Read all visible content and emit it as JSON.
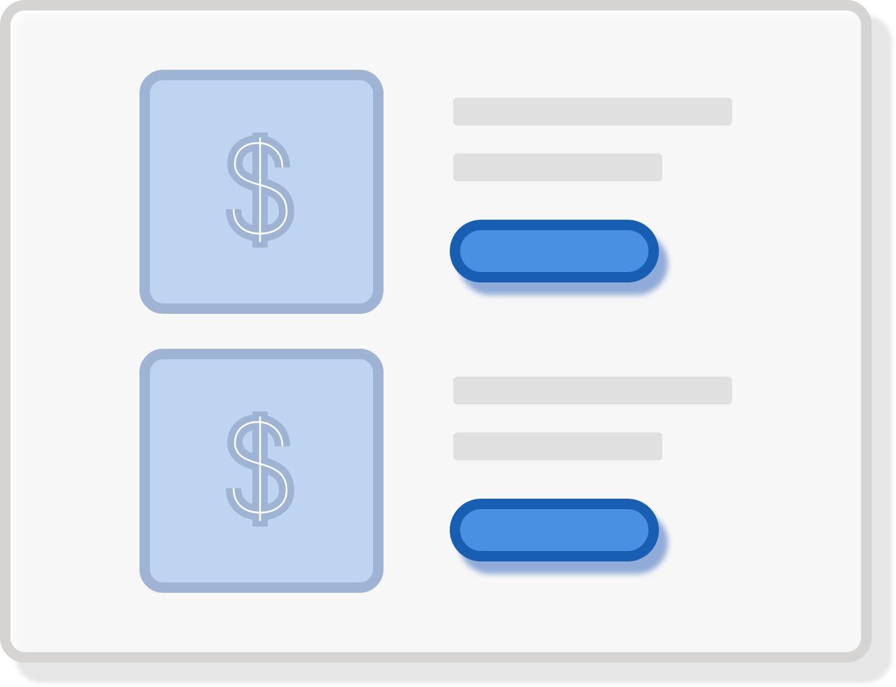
{
  "window": {
    "title": ""
  },
  "list": {
    "items": [
      {
        "icon": "dollar-sign-icon",
        "thumb_bg": "#bfd4f0",
        "thumb_border": "#9fb4d4",
        "primary_button": {
          "label": "",
          "color": "#4a90e2",
          "border": "#185eb2"
        }
      },
      {
        "icon": "dollar-sign-icon",
        "thumb_bg": "#bfd4f0",
        "thumb_border": "#9fb4d4",
        "primary_button": {
          "label": "",
          "color": "#4a90e2",
          "border": "#185eb2"
        }
      }
    ]
  },
  "colors": {
    "frame": "#d5d4d2",
    "surface": "#f7f7f7",
    "placeholder": "#e0e0e0"
  }
}
